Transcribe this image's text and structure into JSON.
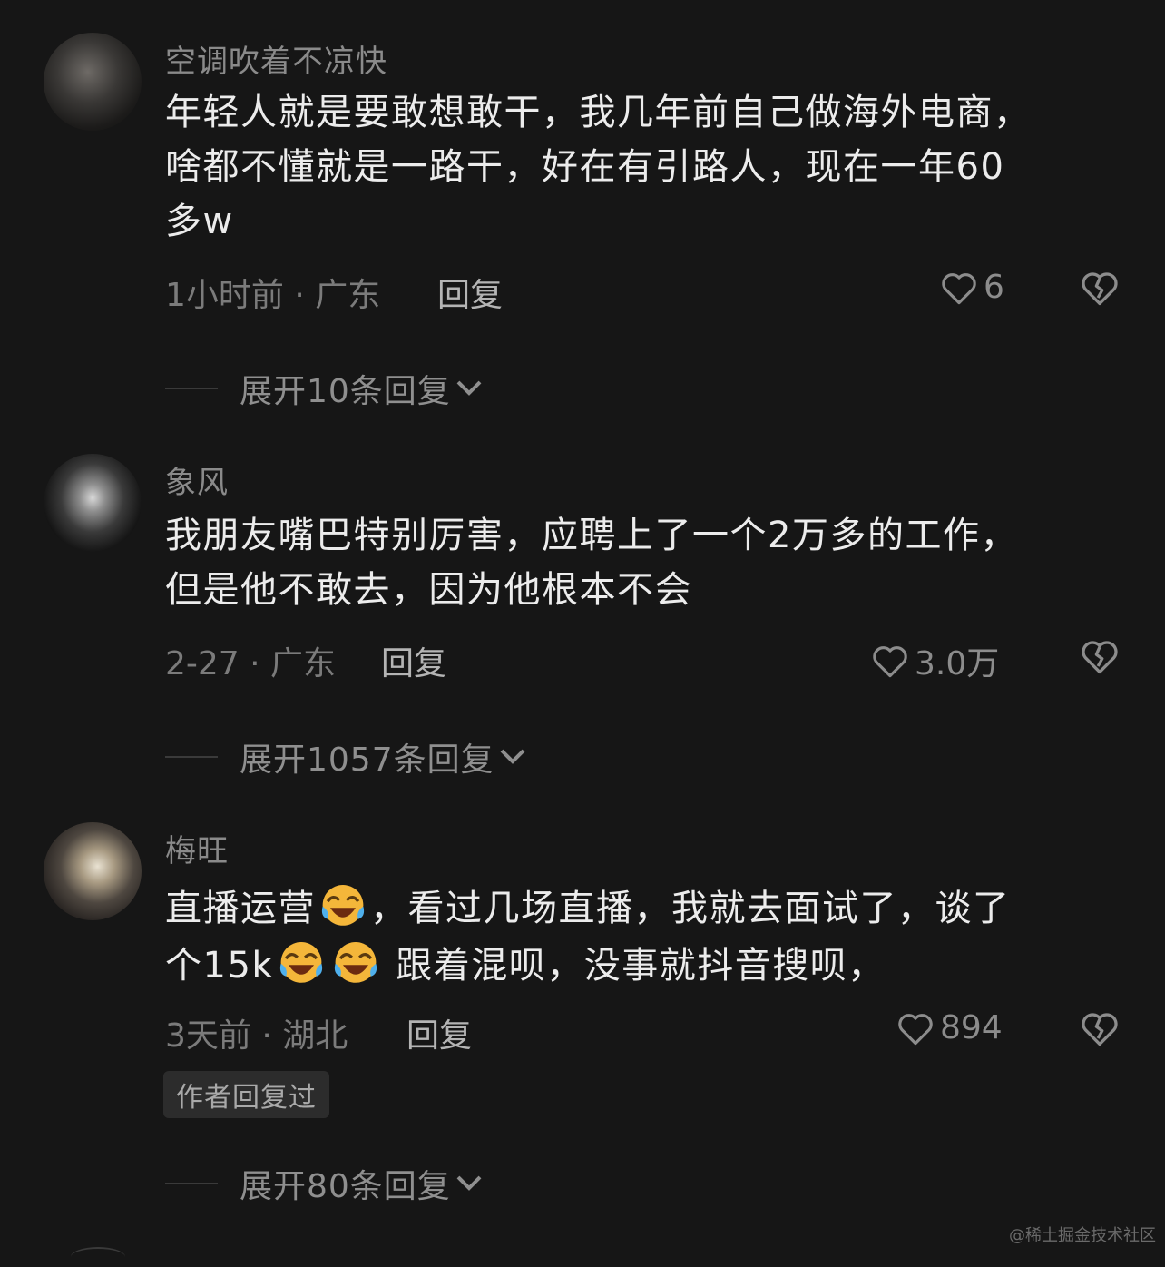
{
  "comments": [
    {
      "username": "空调吹着不凉快",
      "text": "年轻人就是要敢想敢干，我几年前自己做海外电商，\n啥都不懂就是一路干，好在有引路人，现在一年60\n多w",
      "meta": "1小时前 · 广东",
      "reply_label": "回复",
      "likes": "6",
      "expand_label": "展开10条回复"
    },
    {
      "username": "象风",
      "text": "我朋友嘴巴特别厉害，应聘上了一个2万多的工作，\n但是他不敢去，因为他根本不会",
      "meta": "2-27 · 广东",
      "reply_label": "回复",
      "likes": "3.0万",
      "expand_label": "展开1057条回复"
    },
    {
      "username": "梅旺",
      "text_parts": [
        "直播运营",
        "，看过几场直播，我就去面试了，谈了",
        "个15k",
        "跟着混呗，没事就抖音搜呗，"
      ],
      "meta": "3天前 · 湖北",
      "reply_label": "回复",
      "likes": "894",
      "badge": "作者回复过",
      "expand_label": "展开80条回复"
    }
  ],
  "icons": {
    "like": "heart-outline-icon",
    "dislike": "broken-heart-icon",
    "expand": "chevron-down-icon",
    "emoji": "rolling-on-floor-laughing-emoji"
  },
  "watermark": "@稀土掘金技术社区",
  "colors": {
    "background": "#161616",
    "username": "#8a8a8a",
    "text": "#ececec",
    "meta": "#7b7b7b"
  }
}
